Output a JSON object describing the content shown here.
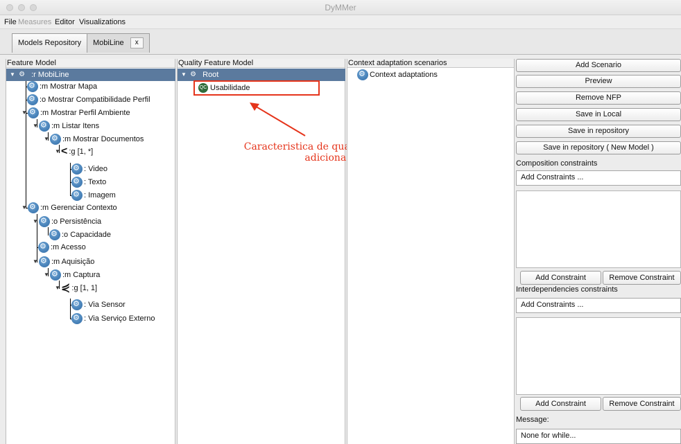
{
  "window": {
    "title": "DyMMer"
  },
  "menu": [
    {
      "label": "File",
      "disabled": false
    },
    {
      "label": "Measures",
      "disabled": true
    },
    {
      "label": "Editor",
      "disabled": false
    },
    {
      "label": "Visualizations",
      "disabled": false
    }
  ],
  "tabs": [
    {
      "label": "Models Repository",
      "active": false
    },
    {
      "label": "MobiLine",
      "active": true,
      "close": "x"
    }
  ],
  "feature_model": {
    "header": "Feature Model",
    "rows": [
      {
        "label": ":r MobiLine",
        "kind": "root"
      },
      {
        "label": ":m Mostrar Mapa"
      },
      {
        "label": ":o Mostrar Compatibilidade Perfil"
      },
      {
        "label": ":m Mostrar Perfil Ambiente"
      },
      {
        "label": ":m Listar Itens"
      },
      {
        "label": ":m Mostrar Documentos"
      },
      {
        "label": ":g [1, *]",
        "kind": "group"
      },
      {
        "label": ": Video"
      },
      {
        "label": ": Texto"
      },
      {
        "label": ": Imagem"
      },
      {
        "label": ":m Gerenciar Contexto"
      },
      {
        "label": ":o Persistência"
      },
      {
        "label": ":o Capacidade"
      },
      {
        "label": ":m Acesso"
      },
      {
        "label": ":m Aquisição"
      },
      {
        "label": ":m Captura"
      },
      {
        "label": ":g [1, 1]",
        "kind": "group"
      },
      {
        "label": ": Via Sensor"
      },
      {
        "label": ": Via Serviço Externo"
      }
    ]
  },
  "quality_model": {
    "header": "Quality Feature Model",
    "root": "Root",
    "child": "Usabilidade",
    "child_badge": "QC"
  },
  "annotation": {
    "line1": "Caracteristica de qualidade",
    "line2": "adicionada",
    "color": "#e5341b"
  },
  "context": {
    "header": "Context adaptation scenarios",
    "item": "Context adaptations"
  },
  "actions": {
    "add_scenario": "Add Scenario",
    "preview": "Preview",
    "remove_nfp": "Remove NFP",
    "save_local": "Save in Local",
    "save_repo": "Save in repository",
    "save_repo_new": "Save in repository ( New Model )"
  },
  "composition": {
    "label": "Composition constraints",
    "combo": "Add Constraints ...",
    "add": "Add Constraint",
    "remove": "Remove Constraint"
  },
  "interdependencies": {
    "label": "Interdependencies constraints",
    "combo": "Add Constraints ...",
    "add": "Add Constraint",
    "remove": "Remove Constraint"
  },
  "message": {
    "label": "Message:",
    "value": "None for while..."
  },
  "colors": {
    "selection": "#5b7a9e",
    "node_icon": "#2f6aa5",
    "qc_icon": "#2f6b3a"
  }
}
